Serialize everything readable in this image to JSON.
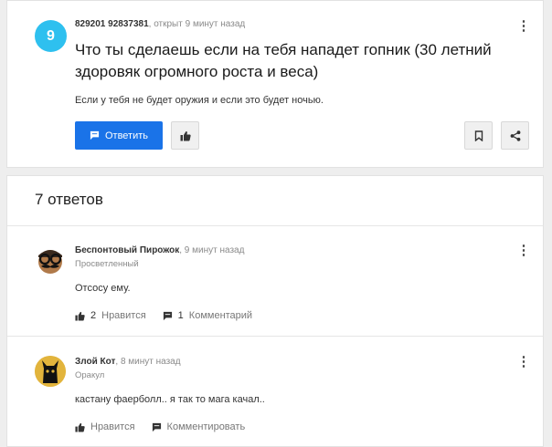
{
  "question": {
    "avatar_letter": "9",
    "author": "829201 92837381",
    "opened": ", открыт 9 минут назад",
    "title": "Что ты сделаешь если на тебя нападет гопник (30 летний здоровяк огромного роста и веса)",
    "text": "Если у тебя не будет оружия и если это будет ночью.",
    "answer_button": "Ответить"
  },
  "answers_count": "7 ответов",
  "answers": [
    {
      "author": "Беспонтовый Пирожок",
      "time": ", 9 минут назад",
      "rank": "Просветленный",
      "text": "Отсосу ему.",
      "likes": "2",
      "like_label": "Нравится",
      "comments": "1",
      "comment_label": "Комментарий"
    },
    {
      "author": "Злой Кот",
      "time": ", 8 минут назад",
      "rank": "Оракул",
      "text": "кастану фаерболл.. я так то мага качал..",
      "like_label": "Нравится",
      "comment_label": "Комментировать"
    }
  ],
  "colors": {
    "accent": "#1a73e8",
    "avatar": "#2ec0ef"
  }
}
